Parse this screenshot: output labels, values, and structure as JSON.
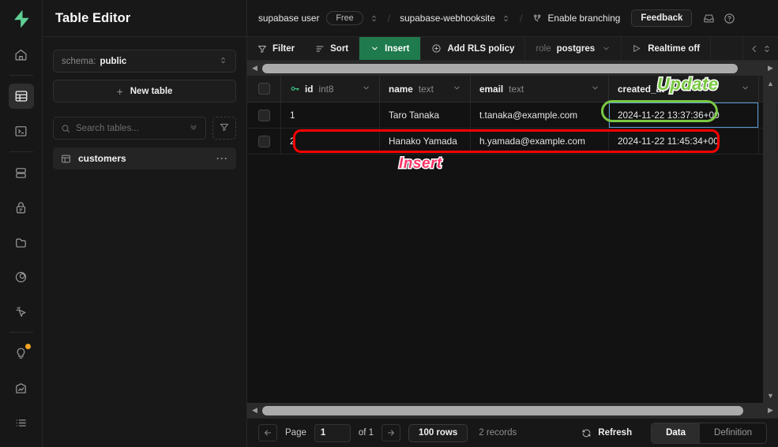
{
  "brand": {
    "logo_icon": "supabase-bolt-logo",
    "accent": "#3ecf8e"
  },
  "rail": {
    "items": [
      {
        "name": "home",
        "icon": "home-icon",
        "active": false
      },
      {
        "name": "table-editor",
        "icon": "table-icon",
        "active": true
      },
      {
        "name": "sql-editor",
        "icon": "terminal-icon",
        "active": false
      },
      {
        "name": "database",
        "icon": "database-icon",
        "active": false
      },
      {
        "name": "authentication",
        "icon": "lock-icon",
        "active": false
      },
      {
        "name": "storage",
        "icon": "folder-icon",
        "active": false
      },
      {
        "name": "edge-functions",
        "icon": "atom-icon",
        "active": false
      },
      {
        "name": "realtime",
        "icon": "cursor-icon",
        "active": false
      },
      {
        "name": "advisors",
        "icon": "lightbulb-icon",
        "active": false,
        "badge": true
      },
      {
        "name": "reports",
        "icon": "bar-chart-icon",
        "active": false
      },
      {
        "name": "logs",
        "icon": "list-icon",
        "active": false
      }
    ]
  },
  "sidebar": {
    "title": "Table Editor",
    "schema": {
      "label": "schema:",
      "value": "public",
      "chevron_icon": "chevron-updown-icon"
    },
    "new_table": {
      "label": "New table",
      "icon": "plus-icon"
    },
    "search": {
      "placeholder": "Search tables...",
      "icon": "search-icon",
      "kbd_icon": "chevron-double-down-icon"
    },
    "filter_button": {
      "icon": "funnel-icon"
    },
    "tables": [
      {
        "name": "customers",
        "icon": "table-icon",
        "more_icon": "ellipsis-icon",
        "selected": true
      }
    ]
  },
  "topbar": {
    "org": "supabase user",
    "plan": "Free",
    "project": "supabase-webhooksite",
    "branching": {
      "label": "Enable branching",
      "icon": "branch-icon"
    },
    "feedback": "Feedback",
    "inbox_icon": "inbox-icon",
    "help_icon": "help-circle-icon",
    "separator": "/"
  },
  "toolbar": {
    "filter": {
      "label": "Filter",
      "icon": "funnel-icon"
    },
    "sort": {
      "label": "Sort",
      "icon": "sort-icon"
    },
    "insert": {
      "label": "Insert",
      "icon": "chevron-down-icon"
    },
    "rls": {
      "label": "Add RLS policy",
      "icon": "plus-circle-icon"
    },
    "role": {
      "prefix": "role",
      "value": "postgres",
      "chevron_icon": "chevron-down-icon"
    },
    "realtime": {
      "label": "Realtime off",
      "icon": "broadcast-icon"
    },
    "collapse_icon": "chevron-left-icon",
    "resize_icon": "chevron-updown-icon"
  },
  "grid": {
    "columns": [
      {
        "key": "select",
        "label": "",
        "type": "",
        "icon": ""
      },
      {
        "key": "id",
        "label": "id",
        "type": "int8",
        "icon": "key-icon",
        "chevron_icon": "chevron-down-icon"
      },
      {
        "key": "name",
        "label": "name",
        "type": "text",
        "icon": "",
        "chevron_icon": "chevron-down-icon"
      },
      {
        "key": "email",
        "label": "email",
        "type": "text",
        "icon": "",
        "chevron_icon": "chevron-down-icon"
      },
      {
        "key": "created_at",
        "label": "created_at",
        "type": "",
        "icon": "",
        "chevron_icon": "chevron-down-icon"
      }
    ],
    "rows": [
      {
        "id": "1",
        "name": "Taro Tanaka",
        "email": "t.tanaka@example.com",
        "created_at": "2024-11-22 13:37:36+00"
      },
      {
        "id": "2",
        "name": "Hanako Yamada",
        "email": "h.yamada@example.com",
        "created_at": "2024-11-22 11:45:34+00"
      }
    ]
  },
  "annotations": [
    {
      "label": "Update",
      "color": "#7ac943",
      "shape": "oval",
      "target": "row-1-created-at-cell"
    },
    {
      "label": "Insert",
      "color": "#ff3368",
      "shape": "rect",
      "target": "row-2"
    }
  ],
  "footer": {
    "prev_icon": "arrow-left-icon",
    "next_icon": "arrow-right-icon",
    "page_label": "Page",
    "page_value": "1",
    "of_label": "of 1",
    "rows_per_page": "100 rows",
    "records": "2 records",
    "refresh": {
      "label": "Refresh",
      "icon": "refresh-icon"
    },
    "segments": [
      {
        "label": "Data",
        "active": true
      },
      {
        "label": "Definition",
        "active": false
      }
    ]
  }
}
